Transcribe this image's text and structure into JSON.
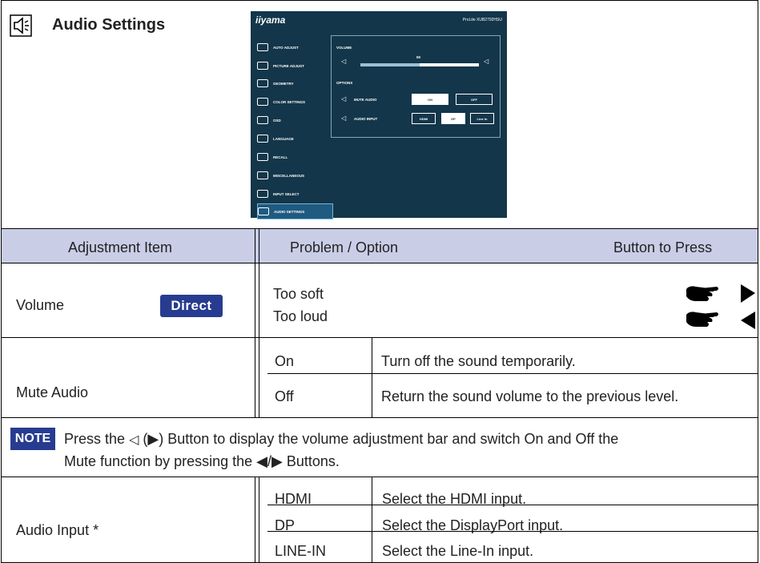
{
  "header": {
    "title": "Audio Settings"
  },
  "osd": {
    "brand": "iiyama",
    "model": "ProLite XUB2792HSU",
    "menu_items": [
      "AUTO ADJUST",
      "PICTURE ADJUST",
      "GEOMETRY",
      "COLOR SETTINGS",
      "OSD",
      "LANGUAGE",
      "RECALL",
      "MISCELLANEOUS",
      "INPUT SELECT",
      "AUDIO SETTINGS"
    ],
    "active_item": "AUDIO SETTINGS",
    "volume_label": "VOLUME",
    "volume_value": "50",
    "volume_level": 0.5,
    "options_label": "OPTIONS",
    "mute_label": "MUTE AUDIO",
    "mute_on": "ON",
    "mute_off": "OFF",
    "input_label": "AUDIO INPUT",
    "input_hdmi": "HDMI",
    "input_dp": "DP",
    "input_linein": "Line In"
  },
  "table": {
    "col_item": "Adjustment Item",
    "col_problem": "Problem / Option",
    "col_button": "Button to Press",
    "volume": {
      "label": "Volume",
      "badge": "Direct",
      "too_soft": "Too soft",
      "too_loud": "Too loud"
    },
    "mute": {
      "label": "Mute Audio",
      "on": "On",
      "on_desc": "Turn off the sound temporarily.",
      "off": "Off",
      "off_desc": "Return the sound volume to the previous level."
    },
    "note": {
      "badge": "NOTE",
      "line1_a": "Press the",
      "line1_b": "(",
      "line1_c": ") Button to display the volume adjustment bar and switch On and Off the",
      "line2_a": "Mute function by pressing the",
      "line2_b": "/",
      "line2_c": "Buttons."
    },
    "audio_input": {
      "label": "Audio Input *",
      "rows": [
        {
          "option": "HDMI",
          "desc": "Select the HDMI input."
        },
        {
          "option": "DP",
          "desc": "Select the DisplayPort input."
        },
        {
          "option": "LINE-IN",
          "desc": "Select the Line-In input."
        }
      ]
    }
  }
}
